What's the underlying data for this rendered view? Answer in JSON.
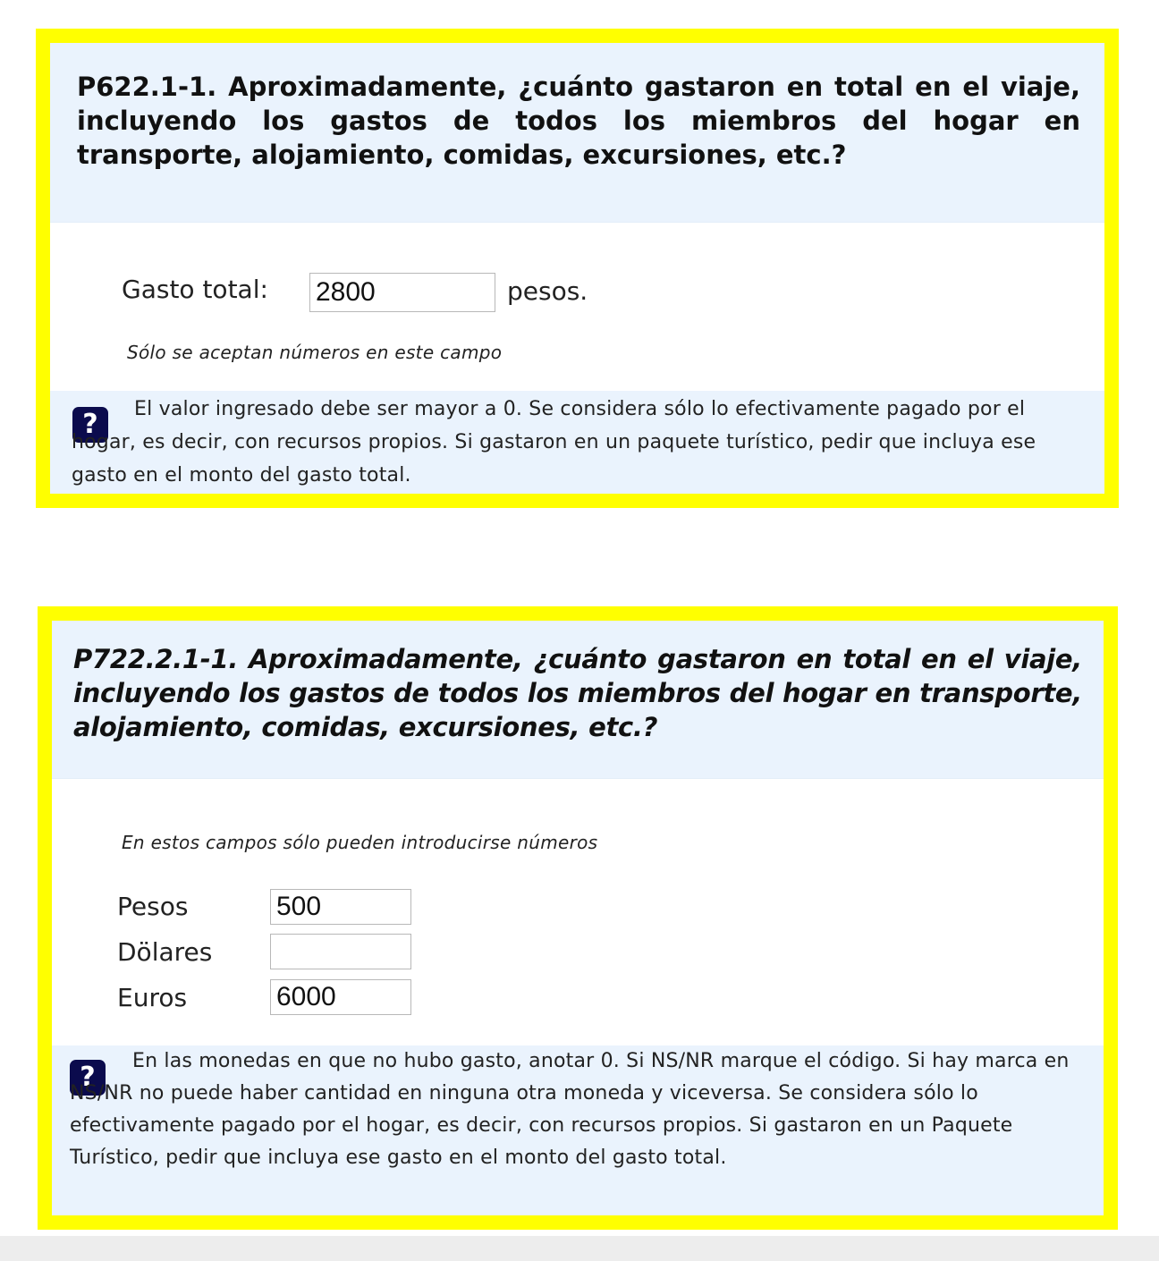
{
  "question1": {
    "title": "P622.1-1. Aproximadamente, ¿cuánto gastaron en total en el viaje, incluyendo los gastos de todos los miembros  del hogar en transporte, alojamiento, comidas, excursiones, etc.?",
    "field_label": "Gasto total:",
    "field_value": "2800",
    "unit": "pesos.",
    "hint": "Sólo se aceptan números en este campo",
    "help_icon": "question-mark-icon",
    "help_icon_glyph": "?",
    "help_text": "El valor ingresado debe ser mayor a 0. Se considera sólo lo efectivamente pagado por el hogar, es decir, con recursos propios. Si gastaron en un paquete turístico, pedir que incluya ese gasto en el monto del gasto total."
  },
  "question2": {
    "title": "P722.2.1-1. Aproximadamente, ¿cuánto gastaron en total en el viaje, incluyendo los gastos de todos los miembros  del hogar en transporte, alojamiento, comidas, excursiones, etc.?",
    "hint": "En estos campos sólo pueden introducirse números",
    "fields": [
      {
        "label": "Pesos",
        "value": "500"
      },
      {
        "label": "Dölares",
        "value": ""
      },
      {
        "label": "Euros",
        "value": "6000"
      }
    ],
    "help_icon": "question-mark-icon",
    "help_icon_glyph": "?",
    "help_text": "En las monedas en que no hubo gasto, anotar 0. Si NS/NR marque el código. Si hay marca en NS/NR no puede haber cantidad en ninguna otra moneda y viceversa. Se considera sólo lo efectivamente pagado por el hogar, es decir, con recursos propios. Si gastaron en un Paquete Turístico, pedir que incluya ese gasto en el monto del gasto total."
  },
  "colors": {
    "highlight_border": "#ffff00",
    "panel_background": "#eaf3fd",
    "help_icon_background": "#0b0b4d"
  }
}
